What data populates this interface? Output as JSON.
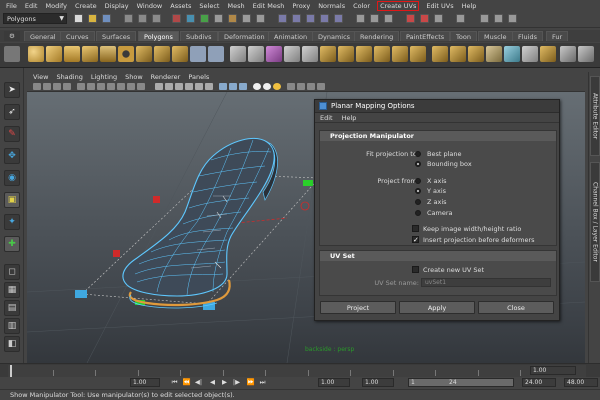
{
  "menus": [
    "File",
    "Edit",
    "Modify",
    "Create",
    "Display",
    "Window",
    "Assets",
    "Select",
    "Mesh",
    "Edit Mesh",
    "Proxy",
    "Normals",
    "Color",
    "Create UVs",
    "Edit UVs",
    "Help"
  ],
  "status": {
    "mode": "Polygons"
  },
  "shelf_tabs": [
    "General",
    "Curves",
    "Surfaces",
    "Polygons",
    "Subdivs",
    "Deformation",
    "Animation",
    "Dynamics",
    "Rendering",
    "PaintEffects",
    "Toon",
    "Muscle",
    "Fluids",
    "Fur"
  ],
  "viewport": {
    "menu": [
      "View",
      "Shading",
      "Lighting",
      "Show",
      "Renderer",
      "Panels"
    ],
    "camera_label": "backside : persp"
  },
  "right_panel": {
    "tabs": [
      "Attribute Editor",
      "Channel Box / Layer Editor"
    ]
  },
  "dialog": {
    "title": "Planar Mapping Options",
    "menu": [
      "Edit",
      "Help"
    ],
    "section_manipulator": "Projection Manipulator",
    "fit_label": "Fit projection to:",
    "fit_options": [
      "Best plane",
      "Bounding box"
    ],
    "fit_selected": "Bounding box",
    "from_label": "Project from:",
    "from_options": [
      "X axis",
      "Y axis",
      "Z axis",
      "Camera"
    ],
    "from_selected": "Y axis",
    "keep_ratio_label": "Keep image width/height ratio",
    "keep_ratio_checked": false,
    "insert_label": "Insert projection before deformers",
    "insert_checked": true,
    "section_uvset": "UV Set",
    "create_uvset_label": "Create new UV Set",
    "create_uvset_checked": false,
    "uvset_name_label": "UV Set name:",
    "uvset_name_value": "uvSet1",
    "buttons": {
      "project": "Project",
      "apply": "Apply",
      "close": "Close"
    }
  },
  "time_slider": {
    "ticks": [
      2,
      4,
      6,
      8,
      10,
      12,
      14,
      16,
      18,
      20,
      22,
      24
    ],
    "current_frame": "1.00"
  },
  "range_slider": {
    "start": "1.00",
    "range_field_start": "1.00",
    "range_field_frame": "1.00",
    "range_bar_start": "1",
    "range_bar_end": "24",
    "end_time": "24.00",
    "anim_end": "48.00"
  },
  "help_line": "Show Manipulator Tool: Use manipulator(s) to edit selected object(s).",
  "colors": {
    "highlight_menu": "#e01818",
    "mesh_wire": "#5ec8ff",
    "background": "#444444"
  }
}
